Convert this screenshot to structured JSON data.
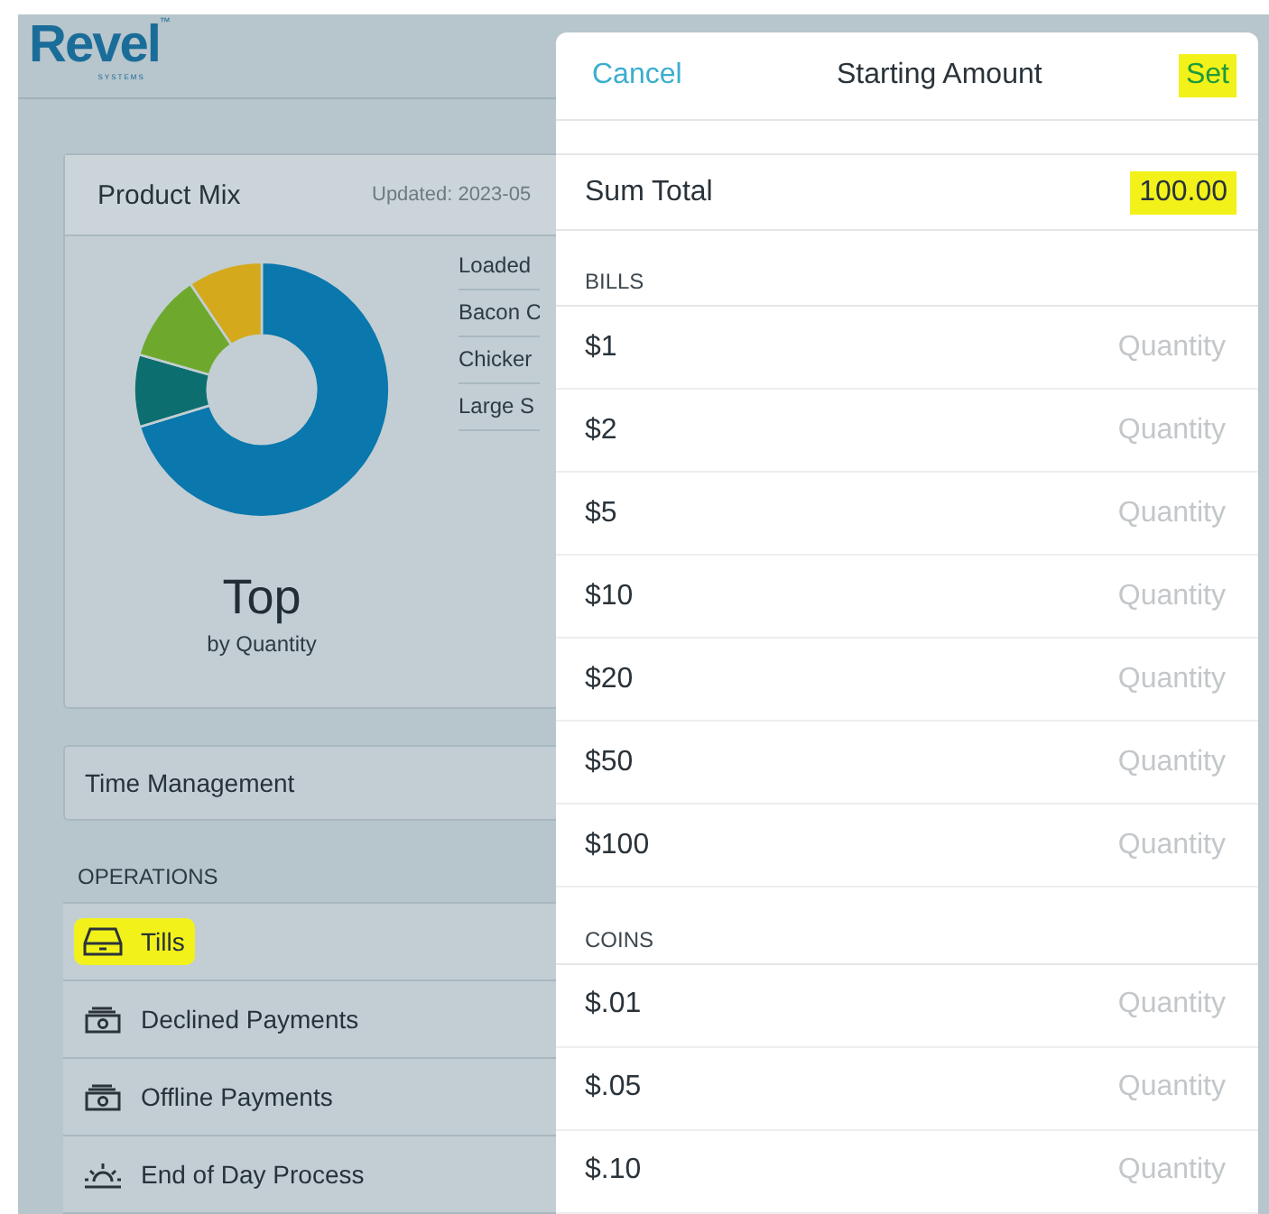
{
  "brand": {
    "name": "Revel",
    "sub": "SYSTEMS",
    "mark": "™"
  },
  "product_mix": {
    "title": "Product Mix",
    "updated": "Updated: 2023-05",
    "legend": [
      "Loaded",
      "Bacon C",
      "Chicker",
      "Large S"
    ],
    "caption": "Top",
    "subcaption": "by Quantity"
  },
  "time_management": {
    "label": "Time Management"
  },
  "operations": {
    "heading": "OPERATIONS",
    "items": [
      {
        "label": "Tills",
        "kind": "drawer",
        "highlighted": true
      },
      {
        "label": "Declined Payments",
        "kind": "cash",
        "highlighted": false
      },
      {
        "label": "Offline Payments",
        "kind": "cash",
        "highlighted": false
      },
      {
        "label": "End of Day Process",
        "kind": "sunset",
        "highlighted": false
      }
    ]
  },
  "dialog": {
    "cancel": "Cancel",
    "title": "Starting Amount",
    "confirm": {
      "label": "Set",
      "highlighted": true
    },
    "sum": {
      "label": "Sum Total",
      "value": "100.00",
      "highlighted": true
    },
    "sections": [
      {
        "heading": "BILLS",
        "rows": [
          {
            "label": "$1",
            "placeholder": "Quantity"
          },
          {
            "label": "$2",
            "placeholder": "Quantity"
          },
          {
            "label": "$5",
            "placeholder": "Quantity"
          },
          {
            "label": "$10",
            "placeholder": "Quantity"
          },
          {
            "label": "$20",
            "placeholder": "Quantity"
          },
          {
            "label": "$50",
            "placeholder": "Quantity"
          },
          {
            "label": "$100",
            "placeholder": "Quantity"
          }
        ]
      },
      {
        "heading": "COINS",
        "rows": [
          {
            "label": "$.01",
            "placeholder": "Quantity"
          },
          {
            "label": "$.05",
            "placeholder": "Quantity"
          },
          {
            "label": "$.10",
            "placeholder": "Quantity"
          }
        ]
      }
    ]
  }
}
